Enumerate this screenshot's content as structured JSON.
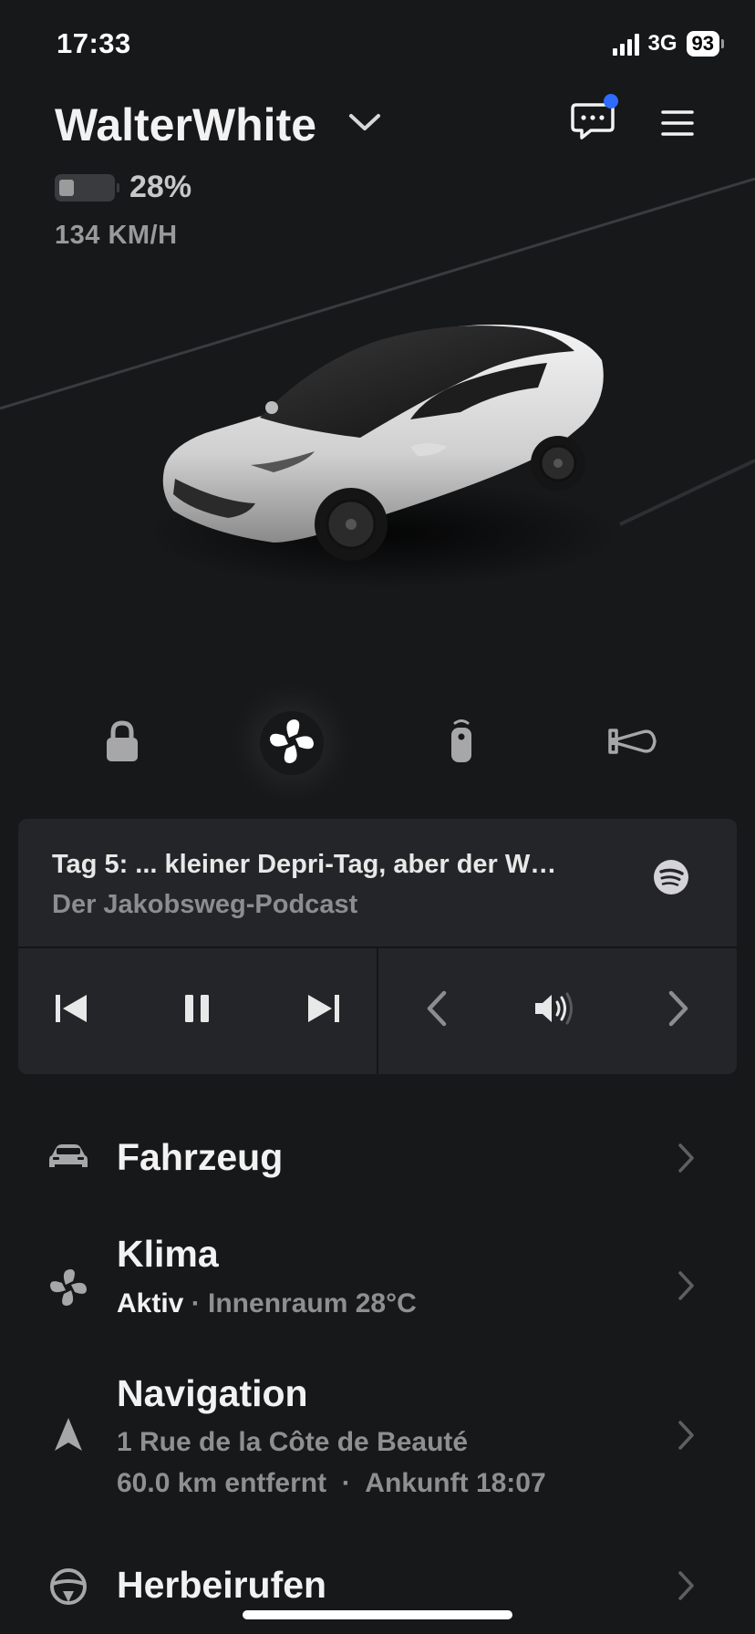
{
  "status_bar": {
    "time": "17:33",
    "network": "3G",
    "battery": "93"
  },
  "header": {
    "car_name": "WalterWhite",
    "battery_percent": "28%",
    "battery_level": 0.28,
    "speed": "134 KM/H"
  },
  "quick_controls": [
    {
      "name": "lock",
      "icon": "lock-icon"
    },
    {
      "name": "climate",
      "icon": "fan-icon"
    },
    {
      "name": "remote",
      "icon": "remote-key-icon"
    },
    {
      "name": "horn",
      "icon": "horn-icon"
    }
  ],
  "media": {
    "title": "Tag 5: ... kleiner Depri-Tag, aber der W…",
    "subtitle": "Der Jakobsweg-Podcast",
    "source_icon": "spotify-icon"
  },
  "menu": {
    "vehicle": {
      "title": "Fahrzeug"
    },
    "climate": {
      "title": "Klima",
      "status": "Aktiv",
      "detail": " · Innenraum 28°C"
    },
    "navigation": {
      "title": "Navigation",
      "address": "1 Rue de la Côte de Beauté",
      "info": "60.0 km entfernt  ·  Ankunft 18:07"
    },
    "summon": {
      "title": "Herbeirufen"
    }
  },
  "colors": {
    "background": "#17181a",
    "card": "#242528",
    "notification_dot": "#2f6bff"
  }
}
